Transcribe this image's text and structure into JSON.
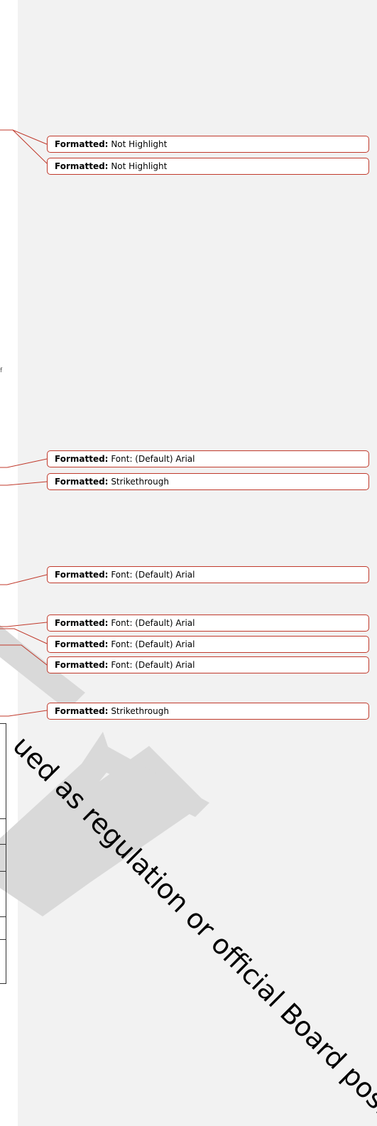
{
  "stray_text": "f",
  "balloons": [
    {
      "label": "Formatted:",
      "value": "Not Highlight"
    },
    {
      "label": "Formatted:",
      "value": "Not Highlight"
    },
    {
      "label": "Formatted:",
      "value": "Font: (Default) Arial"
    },
    {
      "label": "Formatted:",
      "value": "Strikethrough"
    },
    {
      "label": "Formatted:",
      "value": "Font: (Default) Arial"
    },
    {
      "label": "Formatted:",
      "value": "Font: (Default) Arial"
    },
    {
      "label": "Formatted:",
      "value": "Font: (Default) Arial"
    },
    {
      "label": "Formatted:",
      "value": "Font: (Default) Arial"
    },
    {
      "label": "Formatted:",
      "value": "Strikethrough"
    }
  ],
  "watermark": {
    "text": "ued as regulation or official Board posi",
    "color": "#d4d4d4"
  },
  "colors": {
    "balloon_border": "#c0392b",
    "connector": "#c0392b",
    "margin_background": "#f2f2f2"
  }
}
